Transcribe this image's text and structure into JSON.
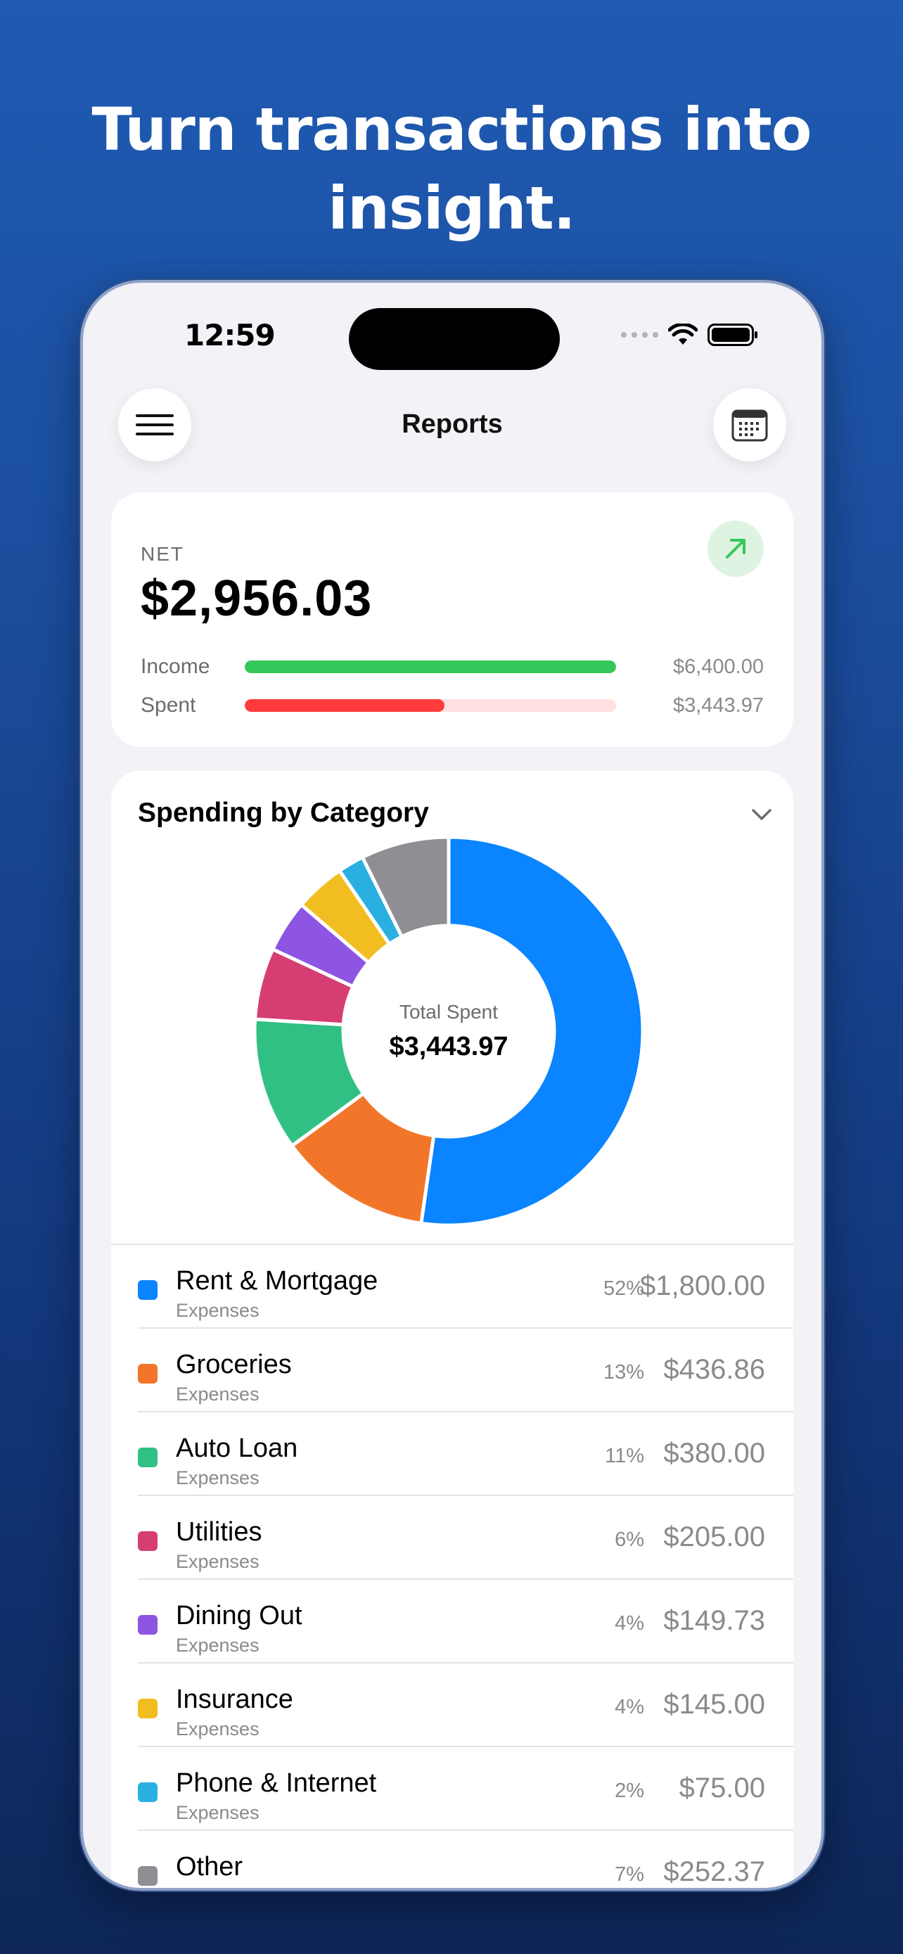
{
  "headline": {
    "line1": "Turn transactions into",
    "line2": "insight."
  },
  "status_bar": {
    "time": "12:59"
  },
  "nav": {
    "title": "Reports",
    "menu_icon": "hamburger-menu-icon",
    "calendar_icon": "calendar-icon"
  },
  "net": {
    "label": "NET",
    "value": "$2,956.03",
    "trend_icon": "arrow-up-right-icon",
    "income_label": "Income",
    "income_amount": "$6,400.00",
    "income_fraction": 1.0,
    "spent_label": "Spent",
    "spent_amount": "$3,443.97",
    "spent_fraction": 0.538,
    "colors": {
      "income": "#34c759",
      "spent": "#ff3b3b",
      "spent_track": "#ffe0e0",
      "income_track": "#e2f5e6"
    }
  },
  "spending": {
    "title": "Spending by Category",
    "center_label": "Total Spent",
    "center_value": "$3,443.97"
  },
  "chart_data": {
    "type": "pie",
    "categories": [
      "Rent & Mortgage",
      "Groceries",
      "Auto Loan",
      "Utilities",
      "Dining Out",
      "Insurance",
      "Phone & Internet",
      "Other"
    ],
    "values": [
      1800.0,
      436.86,
      380.0,
      205.0,
      149.73,
      145.0,
      75.0,
      252.37
    ],
    "colors": [
      "#0a84ff",
      "#f2762a",
      "#30c084",
      "#d63d73",
      "#8e55e3",
      "#f2bd20",
      "#2ab0e0",
      "#8e8e93"
    ]
  },
  "categories": [
    {
      "name": "Rent & Mortgage",
      "group": "Expenses",
      "pct": "52%",
      "amount": "$1,800.00",
      "color": "#0a84ff"
    },
    {
      "name": "Groceries",
      "group": "Expenses",
      "pct": "13%",
      "amount": "$436.86",
      "color": "#f2762a"
    },
    {
      "name": "Auto Loan",
      "group": "Expenses",
      "pct": "11%",
      "amount": "$380.00",
      "color": "#30c084"
    },
    {
      "name": "Utilities",
      "group": "Expenses",
      "pct": "6%",
      "amount": "$205.00",
      "color": "#d63d73"
    },
    {
      "name": "Dining Out",
      "group": "Expenses",
      "pct": "4%",
      "amount": "$149.73",
      "color": "#8e55e3"
    },
    {
      "name": "Insurance",
      "group": "Expenses",
      "pct": "4%",
      "amount": "$145.00",
      "color": "#f2bd20"
    },
    {
      "name": "Phone & Internet",
      "group": "Expenses",
      "pct": "2%",
      "amount": "$75.00",
      "color": "#2ab0e0"
    },
    {
      "name": "Other",
      "group": "",
      "pct": "7%",
      "amount": "$252.37",
      "color": "#8e8e93"
    }
  ]
}
